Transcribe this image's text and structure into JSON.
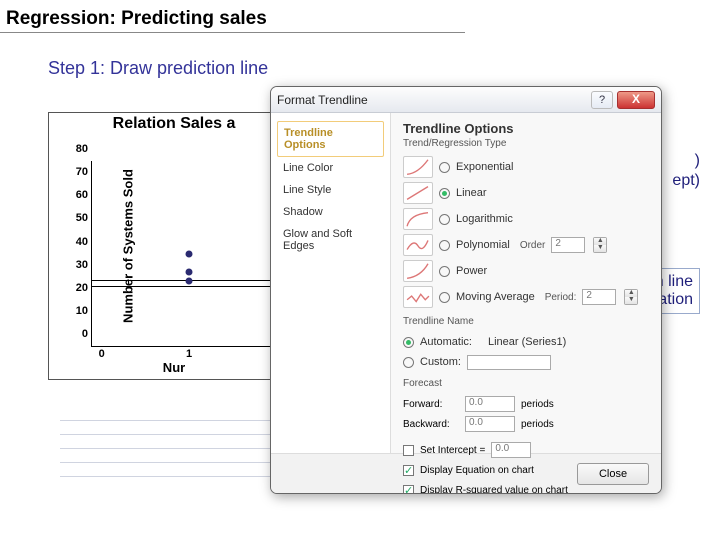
{
  "title": "Regression: Predicting sales",
  "subtitle": "Step 1: Draw prediction line",
  "chart": {
    "title": "Relation Sales a",
    "ylabel": "Number of Systems Sold",
    "xlabel": "Nur",
    "yticks": [
      "0",
      "10",
      "20",
      "30",
      "40",
      "50",
      "60",
      "70",
      "80"
    ],
    "xticks": [
      "0",
      "1"
    ]
  },
  "side_notes": {
    "a": ")",
    "b": "ept)",
    "c": "n line",
    "d": "quation"
  },
  "dialog": {
    "title": "Format Trendline",
    "help": "?",
    "close_x": "X",
    "sidebar": [
      "Trendline Options",
      "Line Color",
      "Line Style",
      "Shadow",
      "Glow and Soft Edges"
    ],
    "section_title": "Trendline Options",
    "section_sub": "Trend/Regression Type",
    "types": [
      {
        "label": "Exponential",
        "checked": false
      },
      {
        "label": "Linear",
        "checked": true
      },
      {
        "label": "Logarithmic",
        "checked": false
      },
      {
        "label": "Polynomial",
        "checked": false,
        "extra": "Order",
        "val": "2"
      },
      {
        "label": "Power",
        "checked": false
      },
      {
        "label": "Moving Average",
        "checked": false,
        "extra": "Period:",
        "val": "2"
      }
    ],
    "name_title": "Trendline Name",
    "name_auto": "Automatic:",
    "name_auto_val": "Linear (Series1)",
    "name_custom": "Custom:",
    "forecast_title": "Forecast",
    "forecast_fwd": "Forward:",
    "forecast_bwd": "Backward:",
    "forecast_val": "0.0",
    "forecast_unit": "periods",
    "chk_intercept": "Set Intercept =",
    "intercept_val": "0.0",
    "chk_eq": "Display Equation on chart",
    "chk_r2": "Display R-squared value on chart",
    "close_btn": "Close"
  },
  "chart_data": {
    "type": "scatter",
    "title": "Relationship between Sales and ...",
    "xlabel": "Number of ...",
    "ylabel": "Number of Systems Sold",
    "x": [
      1,
      1,
      1
    ],
    "y": [
      28,
      32,
      40
    ],
    "trendline": {
      "type": "linear",
      "visible": true
    },
    "ylim": [
      0,
      80
    ],
    "yticks": [
      0,
      10,
      20,
      30,
      40,
      50,
      60,
      70,
      80
    ],
    "xticks_visible": [
      0,
      1
    ]
  }
}
